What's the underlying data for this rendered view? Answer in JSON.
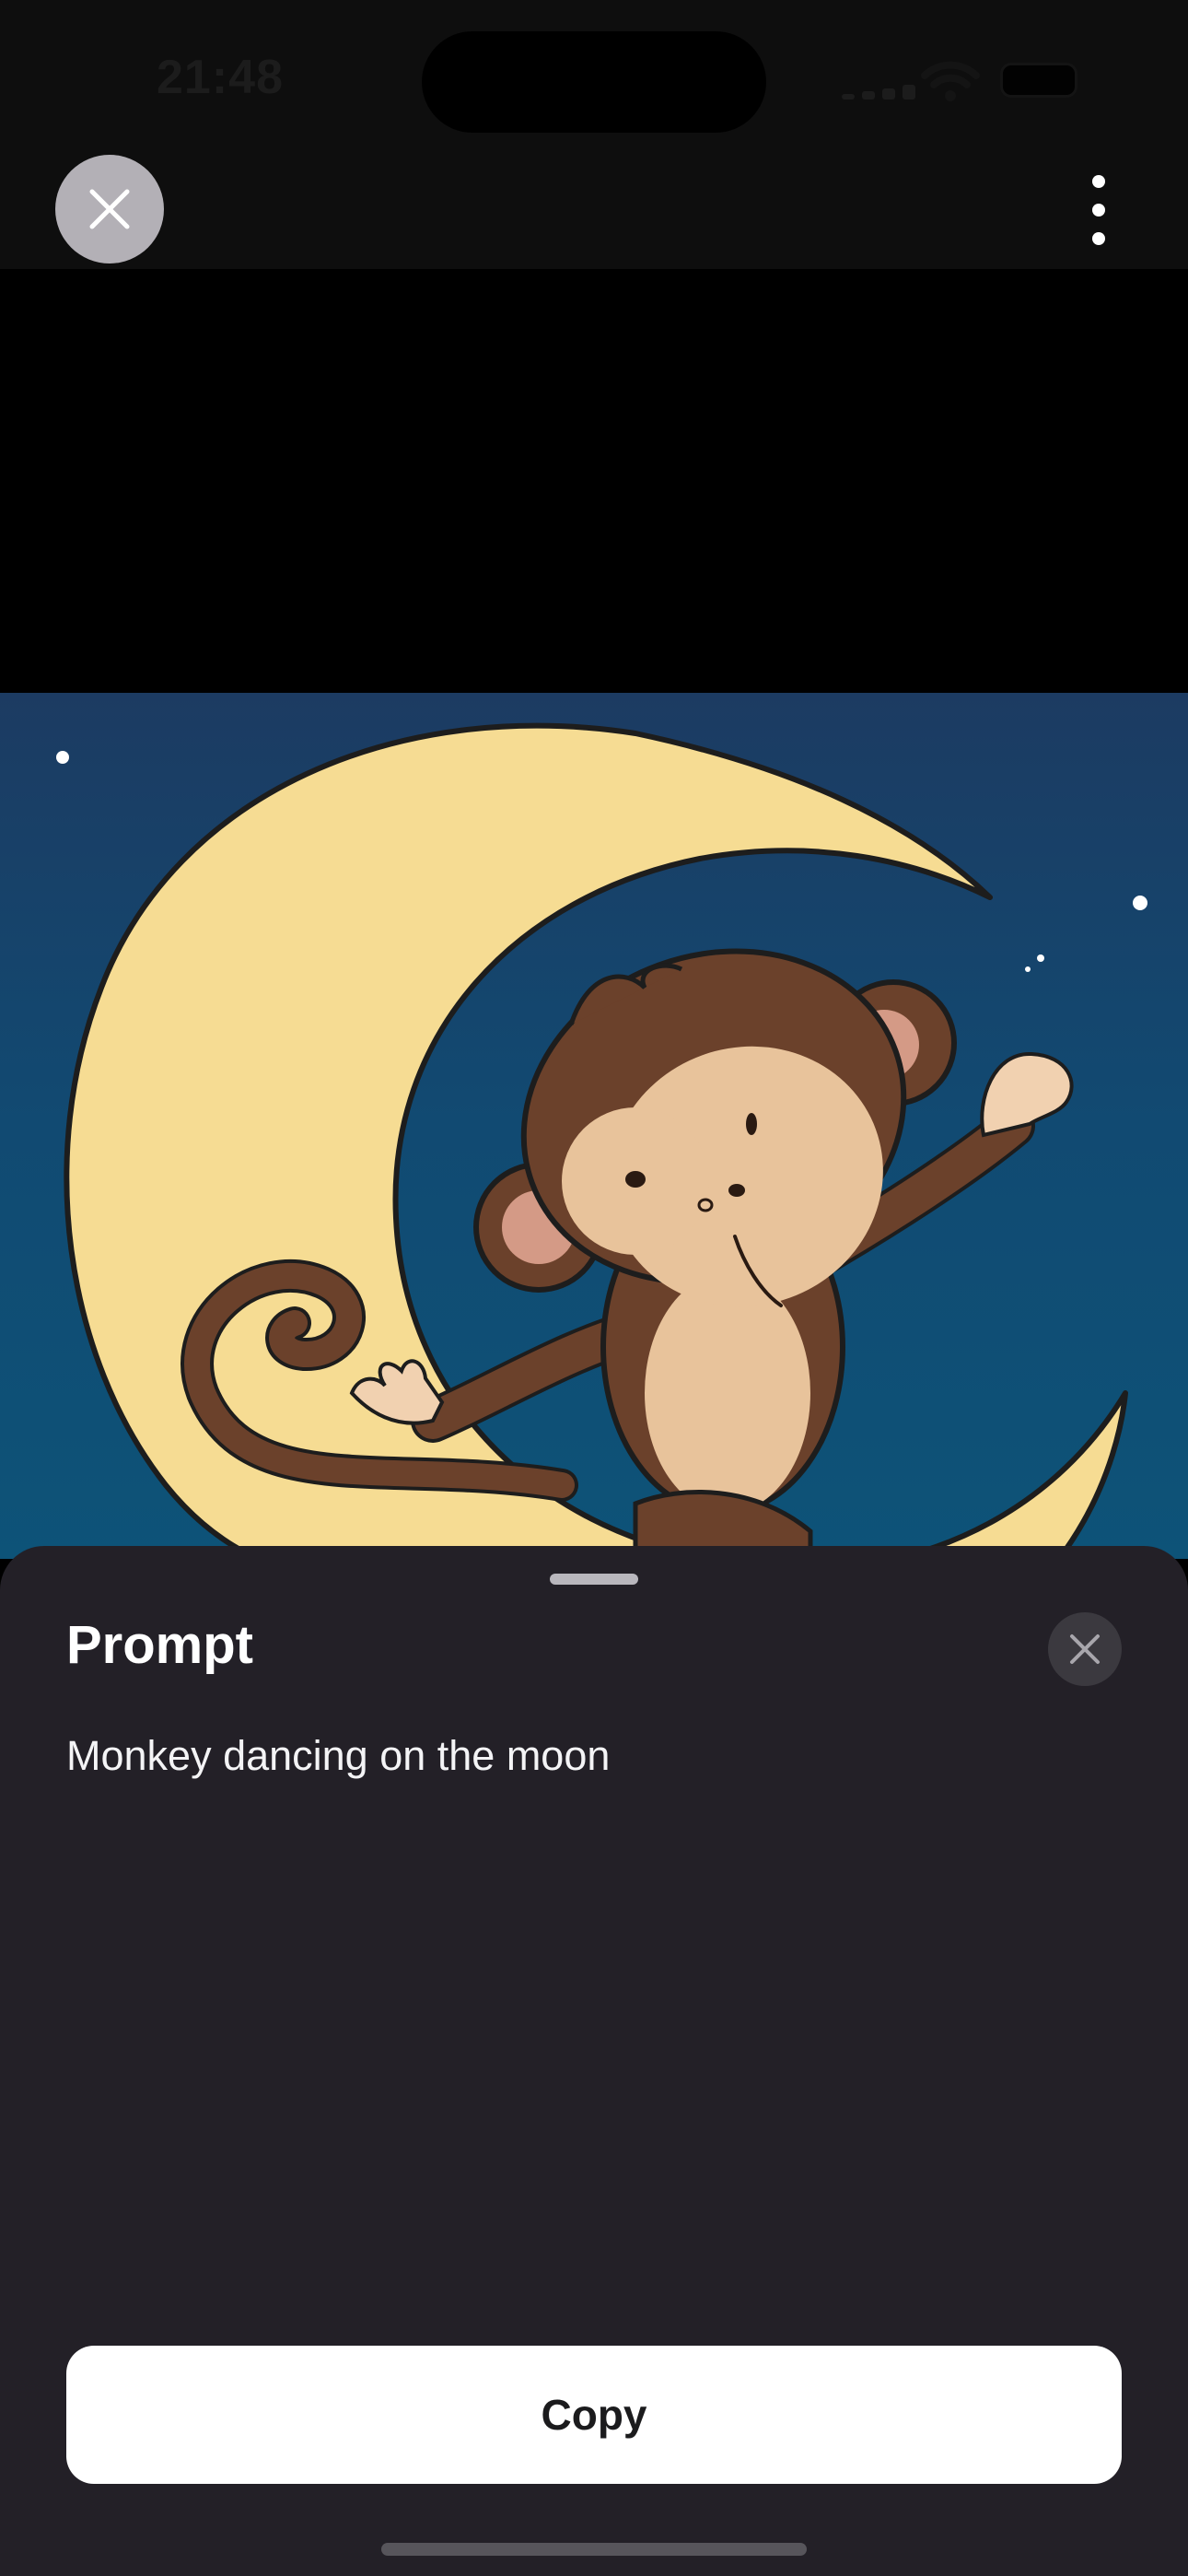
{
  "status_bar": {
    "time": "21:48",
    "icons": [
      "cellular-signal-icon",
      "wifi-icon",
      "battery-icon"
    ]
  },
  "top_bar": {
    "close_icon": "close-icon",
    "more_icon": "more-vertical-icon"
  },
  "image": {
    "subject": "Cartoon monkey dancing on a crescent moon in a starry night sky",
    "colors": {
      "sky_top": "#1c3b62",
      "sky_bottom": "#0d5378",
      "moon": "#f6dc93",
      "monkey_fur": "#6b412b",
      "monkey_face": "#e8c39b"
    }
  },
  "sheet": {
    "title": "Prompt",
    "prompt": "Monkey dancing on the moon",
    "copy_label": "Copy",
    "close_icon": "close-icon"
  },
  "colors": {
    "sheet_bg": "#232027",
    "button_bg": "#ffffff",
    "button_text": "#1b1b1d"
  }
}
